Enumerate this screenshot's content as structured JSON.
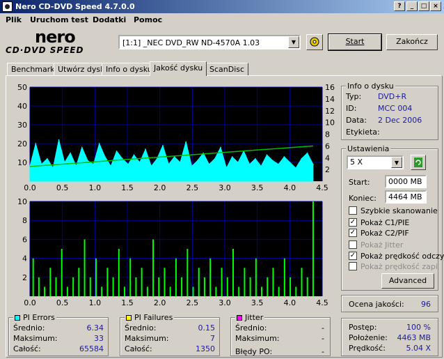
{
  "window": {
    "title": "Nero CD-DVD Speed 4.7.0.0"
  },
  "menu": [
    "Plik",
    "Uruchom test",
    "Dodatki",
    "Pomoc"
  ],
  "logo": {
    "top": "nero",
    "bottom": "CD·DVD SPEED"
  },
  "drive": {
    "value": "[1:1]  _NEC DVD_RW ND-4570A 1.03"
  },
  "buttons": {
    "start": "Start",
    "end": "Zakończ",
    "advanced": "Advanced"
  },
  "tabs": [
    "Benchmark",
    "Utwórz dysk",
    "Info o dysku",
    "Jakość dysku",
    "ScanDisc"
  ],
  "disc_info": {
    "title": "Info o dysku",
    "rows": [
      {
        "label": "Typ:",
        "value": "DVD+R"
      },
      {
        "label": "ID:",
        "value": "MCC 004"
      },
      {
        "label": "Data:",
        "value": "2 Dec 2006"
      },
      {
        "label": "Etykieta:",
        "value": ""
      }
    ]
  },
  "settings": {
    "title": "Ustawienia",
    "speed": "5 X",
    "start_label": "Start:",
    "start_value": "0000 MB",
    "end_label": "Koniec:",
    "end_value": "4464 MB",
    "checks": [
      {
        "label": "Szybkie skanowanie",
        "checked": false,
        "enabled": true
      },
      {
        "label": "Pokaż C1/PIE",
        "checked": true,
        "enabled": true
      },
      {
        "label": "Pokaż C2/PIF",
        "checked": true,
        "enabled": true
      },
      {
        "label": "Pokaż Jitter",
        "checked": false,
        "enabled": false
      },
      {
        "label": "Pokaż prędkość odczy",
        "checked": true,
        "enabled": true
      },
      {
        "label": "Pokaż prędkość zapisu",
        "checked": false,
        "enabled": false
      }
    ]
  },
  "quality": {
    "label": "Ocena jakości:",
    "value": "96"
  },
  "progress": {
    "rows": [
      {
        "label": "Postęp:",
        "value": "100 %"
      },
      {
        "label": "Położenie:",
        "value": "4463 MB"
      },
      {
        "label": "Prędkość:",
        "value": "5.04 X"
      }
    ]
  },
  "pi_errors": {
    "title": "PI Errors",
    "color": "#00ffff",
    "rows": [
      {
        "label": "Średnio:",
        "value": "6.34"
      },
      {
        "label": "Maksimum:",
        "value": "33"
      },
      {
        "label": "Całość:",
        "value": "65584"
      }
    ]
  },
  "pi_failures": {
    "title": "PI Failures",
    "color": "#ffff00",
    "rows": [
      {
        "label": "Średnio:",
        "value": "0.15"
      },
      {
        "label": "Maksimum:",
        "value": "7"
      },
      {
        "label": "Całość:",
        "value": "1350"
      }
    ]
  },
  "jitter": {
    "title": "Jitter",
    "color": "#ff00ff",
    "rows": [
      {
        "label": "Średnio:",
        "value": "-"
      },
      {
        "label": "Maksimum:",
        "value": "-"
      }
    ],
    "po_label": "Błędy PO:",
    "po_value": "-"
  },
  "chart_data": [
    {
      "type": "area",
      "series": [
        {
          "values": [
            8,
            20,
            9,
            12,
            7,
            22,
            10,
            15,
            8,
            18,
            11,
            9,
            20,
            13,
            8,
            16,
            12,
            9,
            14,
            10,
            17,
            8,
            12,
            19,
            9,
            13,
            10,
            21,
            8,
            11,
            15,
            9,
            12,
            18,
            7,
            13,
            10,
            16,
            9,
            12,
            8,
            14,
            11,
            9,
            13,
            10,
            7,
            12,
            15,
            9
          ]
        }
      ],
      "x_ticks": [
        "0.0",
        "0.5",
        "1.0",
        "1.5",
        "2.0",
        "2.5",
        "3.0",
        "3.5",
        "4.0",
        "4.5"
      ],
      "xlim": [
        0,
        4.5
      ],
      "y_left": [
        "10",
        "20",
        "30",
        "40",
        "50"
      ],
      "ylim": [
        0,
        50
      ],
      "y_right": [
        "2",
        "4",
        "6",
        "8",
        "10",
        "12",
        "14",
        "16"
      ],
      "ylim_right": [
        0,
        16
      ],
      "speed_line": {
        "x": [
          0,
          4.36
        ],
        "y": [
          2.5,
          6.0
        ]
      }
    },
    {
      "type": "bar",
      "series": [
        {
          "values": [
            4,
            2,
            1,
            3,
            2,
            5,
            1,
            2,
            3,
            6,
            2,
            4,
            1,
            3,
            2,
            5,
            1,
            4,
            2,
            3,
            1,
            6,
            2,
            3,
            1,
            4,
            2,
            5,
            1,
            3,
            2,
            4,
            1,
            3,
            2,
            5,
            1,
            3,
            2,
            4,
            1,
            2,
            3,
            1,
            4,
            2,
            1,
            3,
            2,
            10
          ]
        }
      ],
      "x_ticks": [
        "0.0",
        "0.5",
        "1.0",
        "1.5",
        "2.0",
        "2.5",
        "3.0",
        "3.5",
        "4.0",
        "4.5"
      ],
      "xlim": [
        0,
        4.5
      ],
      "y_left": [
        "2",
        "4",
        "6",
        "8",
        "10"
      ],
      "ylim": [
        0,
        10
      ]
    }
  ]
}
